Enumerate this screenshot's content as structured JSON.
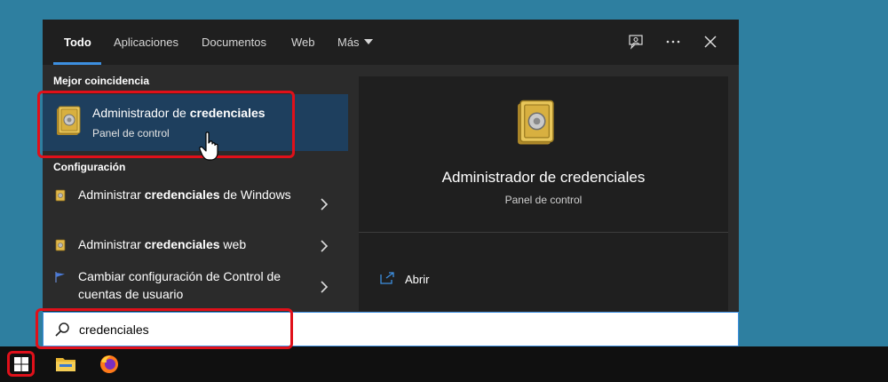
{
  "tabs": [
    {
      "label": "Todo",
      "active": true
    },
    {
      "label": "Aplicaciones"
    },
    {
      "label": "Documentos"
    },
    {
      "label": "Web"
    },
    {
      "label": "Más"
    }
  ],
  "toolbar_icons": [
    "feedback-icon",
    "more-options-icon",
    "close-icon"
  ],
  "best_match": {
    "heading": "Mejor coincidencia",
    "title_prefix": "Administrador de ",
    "title_bold": "credenciales",
    "subtitle": "Panel de control",
    "icon": "safe-icon"
  },
  "settings": {
    "heading": "Configuración",
    "items": [
      {
        "prefix": "Administrar ",
        "bold": "credenciales",
        "suffix": " de Windows",
        "icon": "credential-icon"
      },
      {
        "prefix": "Administrar ",
        "bold": "credenciales",
        "suffix": " web",
        "icon": "credential-icon"
      },
      {
        "prefix": "Cambiar configuración de Control de cuentas de usuario",
        "bold": "",
        "suffix": "",
        "icon": "uac-flag-icon"
      }
    ]
  },
  "detail": {
    "title": "Administrador de credenciales",
    "subtitle": "Panel de control",
    "actions": [
      {
        "label": "Abrir",
        "icon": "open-icon"
      }
    ]
  },
  "search": {
    "value": "credenciales"
  },
  "taskbar": {
    "items": [
      "windows-start-icon",
      "file-explorer-icon",
      "firefox-icon"
    ]
  },
  "colors": {
    "accent": "#3d8fe0",
    "highlight": "#e0101a",
    "selected": "#1e3f5e",
    "desktop": "#2e7fa0"
  }
}
